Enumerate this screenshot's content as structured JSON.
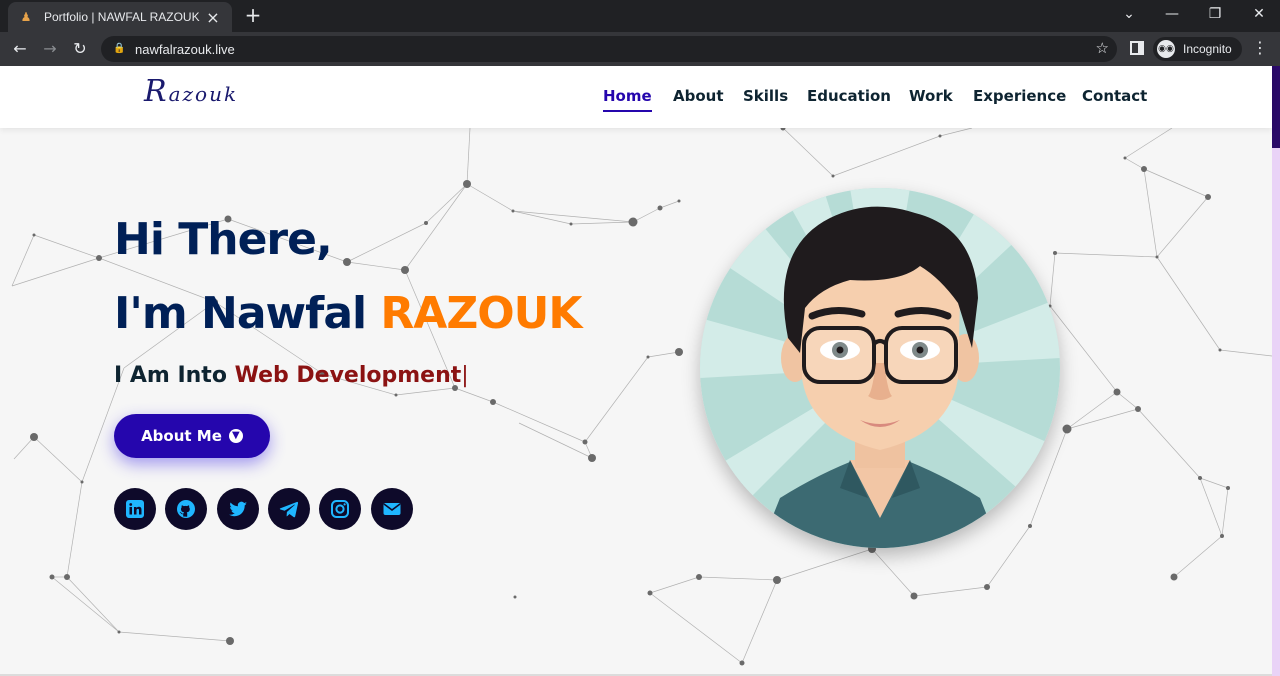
{
  "browser": {
    "tab_title": "Portfolio | NAWFAL RAZOUK",
    "url": "nawfalrazouk.live",
    "profile_label": "Incognito"
  },
  "site": {
    "logo": {
      "initial": "R",
      "rest": "azouk"
    },
    "nav": [
      {
        "label": "Home",
        "active": true
      },
      {
        "label": "About",
        "active": false
      },
      {
        "label": "Skills",
        "active": false
      },
      {
        "label": "Education",
        "active": false
      },
      {
        "label": "Work",
        "active": false
      },
      {
        "label": "Experience",
        "active": false
      },
      {
        "label": "Contact",
        "active": false
      }
    ]
  },
  "hero": {
    "greeting_line1": "Hi There,",
    "greeting_line2_prefix": "I'm Nawfal ",
    "greeting_line2_surname": "RAZOUK",
    "typing_prefix": "I Am Into ",
    "typing_role": "Web Development",
    "typing_caret": "|",
    "about_button": "About Me",
    "socials": [
      "linkedin-icon",
      "github-icon",
      "twitter-icon",
      "telegram-icon",
      "instagram-icon",
      "envelope-icon"
    ]
  },
  "colors": {
    "brand_primary": "#2506ad",
    "heading": "#002057",
    "accent_orange": "#ff7b00",
    "role_red": "#8b1212",
    "social_bg": "#0e0a2a",
    "social_icon": "#1fb6ff"
  }
}
